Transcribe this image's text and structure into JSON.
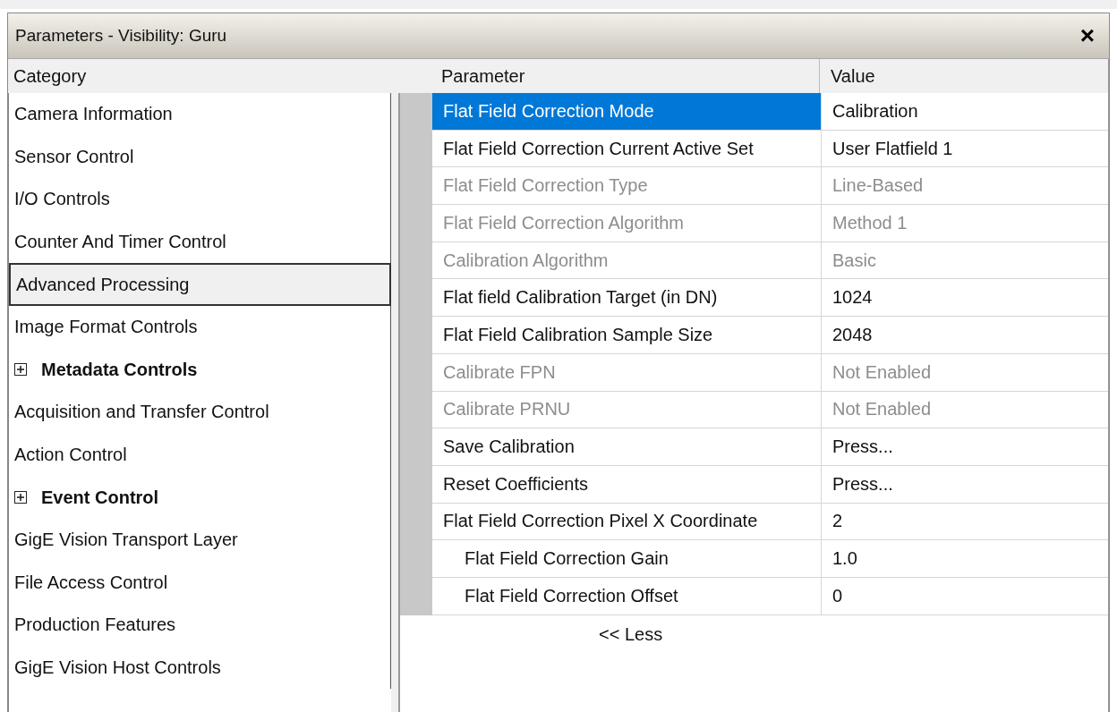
{
  "window": {
    "title": "Parameters - Visibility: Guru",
    "close": "×"
  },
  "category_header": "Category",
  "categories": [
    {
      "label": "Camera Information",
      "selected": false,
      "kind": "plain"
    },
    {
      "label": "Sensor Control",
      "selected": false,
      "kind": "plain"
    },
    {
      "label": "I/O Controls",
      "selected": false,
      "kind": "plain"
    },
    {
      "label": "Counter And Timer Control",
      "selected": false,
      "kind": "plain"
    },
    {
      "label": "Advanced Processing",
      "selected": true,
      "kind": "plain"
    },
    {
      "label": "Image Format Controls",
      "selected": false,
      "kind": "plain"
    },
    {
      "label": "Metadata Controls",
      "selected": false,
      "kind": "group",
      "expanded": false
    },
    {
      "label": "Acquisition and Transfer Control",
      "selected": false,
      "kind": "plain"
    },
    {
      "label": "Action Control",
      "selected": false,
      "kind": "plain"
    },
    {
      "label": "Event Control",
      "selected": false,
      "kind": "group",
      "expanded": false
    },
    {
      "label": "GigE Vision Transport Layer",
      "selected": false,
      "kind": "plain"
    },
    {
      "label": "File Access Control",
      "selected": false,
      "kind": "plain"
    },
    {
      "label": "Production Features",
      "selected": false,
      "kind": "plain"
    },
    {
      "label": "GigE Vision Host Controls",
      "selected": false,
      "kind": "plain"
    }
  ],
  "table": {
    "columns": [
      "Parameter",
      "Value"
    ],
    "rows": [
      {
        "parameter": "Flat Field Correction Mode",
        "value": "Calibration",
        "selected": true,
        "disabled": false
      },
      {
        "parameter": "Flat Field Correction Current Active Set",
        "value": "User Flatfield 1",
        "selected": false,
        "disabled": false
      },
      {
        "parameter": "Flat Field Correction Type",
        "value": "Line-Based",
        "selected": false,
        "disabled": true
      },
      {
        "parameter": "Flat Field Correction Algorithm",
        "value": "Method 1",
        "selected": false,
        "disabled": true
      },
      {
        "parameter": "Calibration Algorithm",
        "value": "Basic",
        "selected": false,
        "disabled": true
      },
      {
        "parameter": "Flat field Calibration Target (in DN)",
        "value": "1024",
        "selected": false,
        "disabled": false
      },
      {
        "parameter": "Flat Field Calibration Sample Size",
        "value": "2048",
        "selected": false,
        "disabled": false
      },
      {
        "parameter": "Calibrate FPN",
        "value": "Not Enabled",
        "selected": false,
        "disabled": true
      },
      {
        "parameter": "Calibrate PRNU",
        "value": "Not Enabled",
        "selected": false,
        "disabled": true
      },
      {
        "parameter": "Save Calibration",
        "value": "Press...",
        "selected": false,
        "disabled": false
      },
      {
        "parameter": "Reset Coefficients",
        "value": "Press...",
        "selected": false,
        "disabled": false
      },
      {
        "parameter": "Flat Field Correction Pixel X Coordinate",
        "value": "2",
        "selected": false,
        "disabled": false,
        "children": [
          {
            "parameter": "Flat Field Correction Gain",
            "value": "1.0",
            "selected": false,
            "disabled": false
          },
          {
            "parameter": "Flat Field Correction Offset",
            "value": "0",
            "selected": false,
            "disabled": false
          }
        ]
      }
    ]
  },
  "less_button": "<< Less"
}
